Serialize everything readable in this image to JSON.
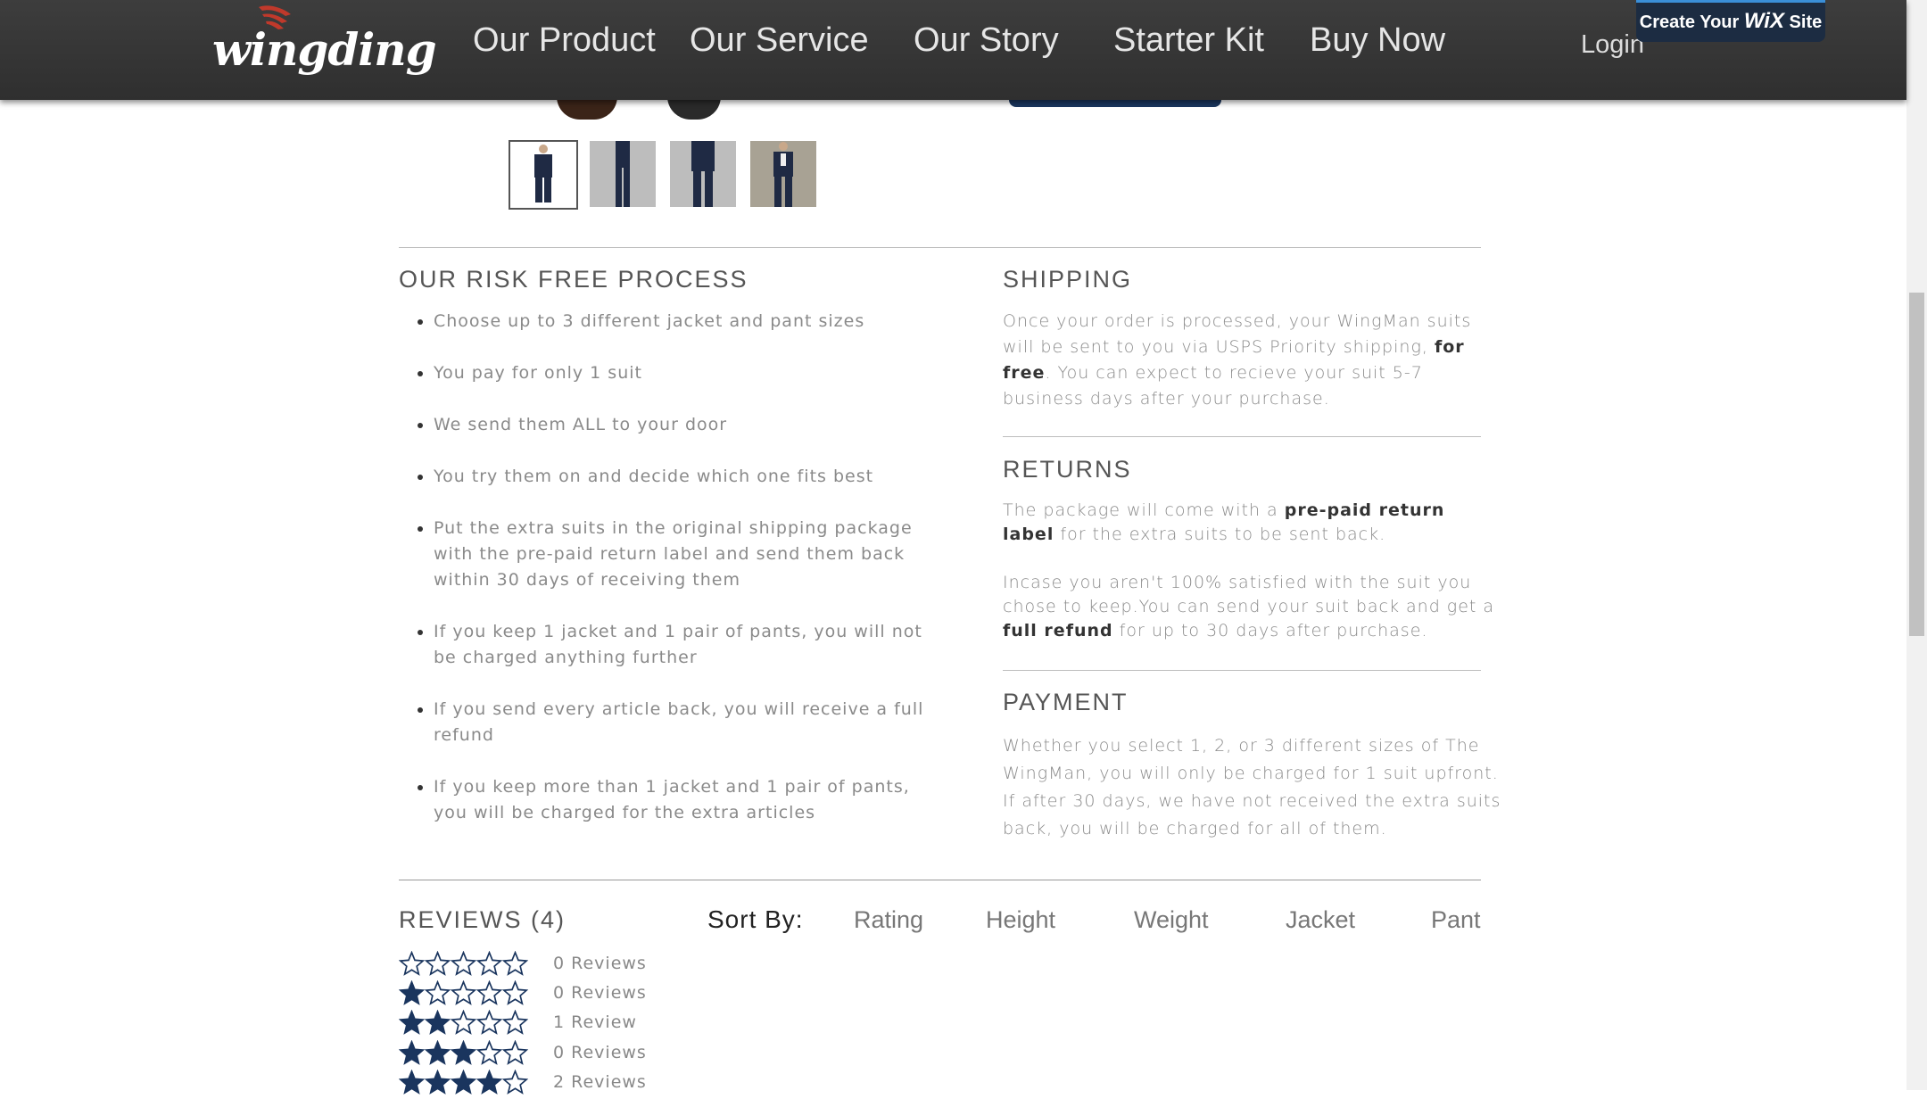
{
  "header": {
    "logo": "wingding",
    "nav": [
      "Our Product",
      "Our Service",
      "Our Story",
      "Starter Kit",
      "Buy Now"
    ],
    "login": "Login",
    "wix_prefix": "Create Your",
    "wix_brand": "WiX",
    "wix_suffix": "Site"
  },
  "process": {
    "title": "OUR RISK FREE PROCESS",
    "steps": [
      "Choose up to 3 different jacket and pant sizes",
      "You pay for only 1 suit",
      "We send them ALL to your door",
      "You try them on and decide which one fits best",
      "Put the extra suits in the original shipping package with the pre-paid return label and send them back within 30 days of receiving them",
      "If you keep 1 jacket and 1 pair of pants, you will not be charged anything further",
      "If you send every article back, you will receive a full refund",
      "If you keep more than 1 jacket and 1 pair of pants, you will be charged for the extra articles"
    ]
  },
  "shipping": {
    "title": "SHIPPING",
    "text_before": "Once your order is processed, your WingMan suits will be sent to you via USPS Priority shipping,",
    "text_bold": "for free",
    "text_after": ". You can expect to recieve your suit 5-7 business days after your purchase."
  },
  "returns": {
    "title": "RETURNS",
    "p1_before": "The package will come with a",
    "p1_bold": "pre-paid return label",
    "p1_after": "for the extra suits to be sent back.",
    "p2_before": "Incase you aren't 100% satisfied with the suit you chose to keep.You can send your suit back and get a",
    "p2_bold": "full refund",
    "p2_after": "for up to 30 days after purchase."
  },
  "payment": {
    "title": "PAYMENT",
    "text": "Whether you select 1, 2, or 3 different sizes of The WingMan, you will only be charged for 1 suit upfront. If after 30 days, we have not received the extra suits back, you will be charged for all of them."
  },
  "reviews": {
    "title": "REVIEWS (4)",
    "sort_label": "Sort By:",
    "sort_options": [
      "Rating",
      "Height",
      "Weight",
      "Jacket",
      "Pant"
    ],
    "rows": [
      {
        "filled": 0,
        "label": "0 Reviews"
      },
      {
        "filled": 1,
        "label": "0 Reviews"
      },
      {
        "filled": 2,
        "label": "1 Review"
      },
      {
        "filled": 3,
        "label": "0 Reviews"
      },
      {
        "filled": 4,
        "label": "2 Reviews"
      }
    ]
  },
  "colors": {
    "header_bg": "#3a3a3a",
    "star": "#1a355e",
    "accent_button": "#1a355e"
  }
}
